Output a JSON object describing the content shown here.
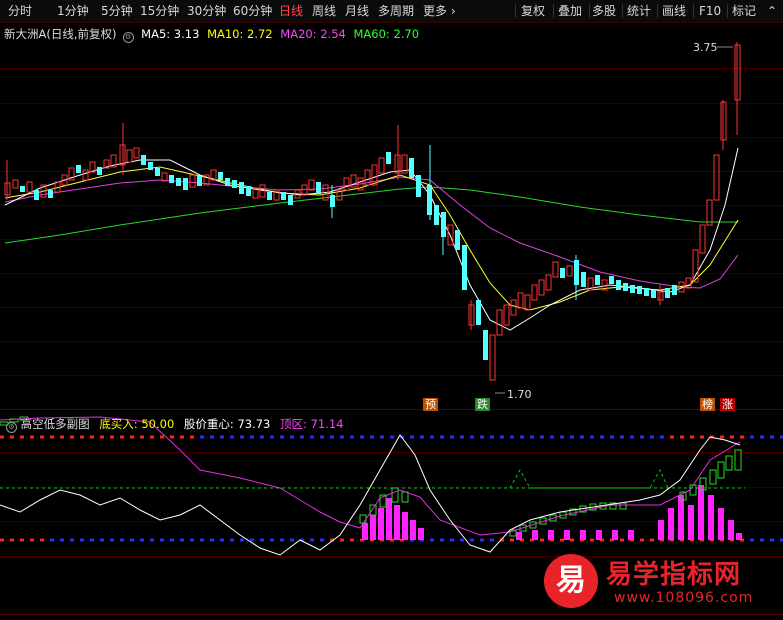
{
  "toolbar": {
    "left_items": [
      "分时",
      "1分钟",
      "5分钟",
      "15分钟",
      "30分钟",
      "60分钟",
      "日线",
      "周线",
      "月线",
      "多周期",
      "更多 ›"
    ],
    "active_index": 6,
    "right_items": [
      "复权",
      "叠加",
      "多股",
      "统计",
      "画线",
      "F10",
      "标记",
      "⌃"
    ]
  },
  "main_chart": {
    "title": "新大洲A(日线,前复权)",
    "ma5": "MA5: 3.13",
    "ma10": "MA10: 2.72",
    "ma20": "MA20: 2.54",
    "ma60": "MA60: 2.70",
    "high_label": "3.75",
    "low_label": "1.70",
    "tags": [
      "预",
      "跌",
      "榜",
      "涨"
    ],
    "colors": {
      "ma5": "#ffffff",
      "ma10": "#ffff00",
      "ma20": "#ff00ff",
      "ma60": "#00ff00",
      "up": "#ff3333",
      "down": "#54ffff"
    }
  },
  "indicator": {
    "title": "高空低多副图",
    "bottom_buy": "底买入: 50.00",
    "center": "股价重心: 73.73",
    "top_zone": "顶区: 71.14",
    "colors": {
      "bottom_buy": "#ffff00",
      "center": "#ffffff",
      "top_zone": "#ff00ff"
    }
  },
  "watermark": {
    "logo_char": "易",
    "title": "易学指标网",
    "url": "www.108096.com"
  }
}
